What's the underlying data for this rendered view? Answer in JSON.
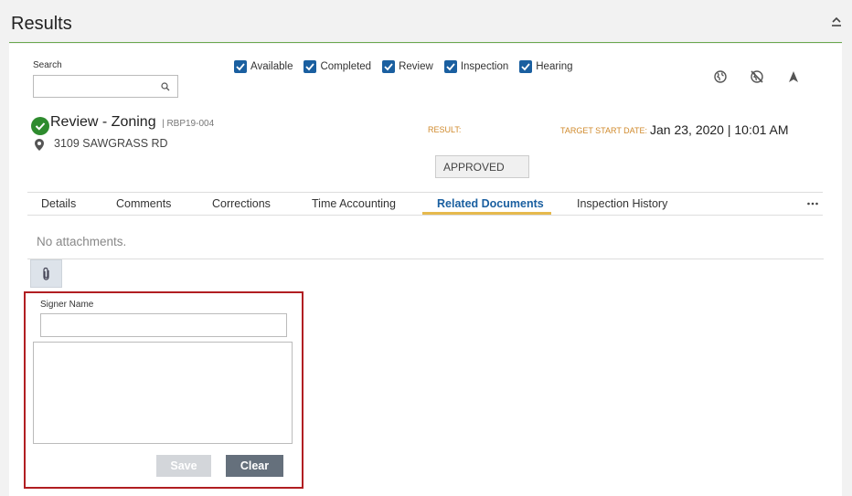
{
  "header": {
    "title": "Results"
  },
  "search": {
    "label": "Search",
    "value": "",
    "placeholder": ""
  },
  "filters": [
    {
      "label": "Available",
      "checked": true
    },
    {
      "label": "Completed",
      "checked": true
    },
    {
      "label": "Review",
      "checked": true
    },
    {
      "label": "Inspection",
      "checked": true
    },
    {
      "label": "Hearing",
      "checked": true
    }
  ],
  "toolbar_icons": [
    "globe-icon",
    "globe-off-icon",
    "navigate-icon"
  ],
  "record": {
    "status": "completed",
    "title": "Review - Zoning",
    "id": "| RBP19-004",
    "address": "3109 SAWGRASS RD"
  },
  "result": {
    "label": "RESULT:",
    "value": "APPROVED"
  },
  "target": {
    "label": "TARGET START DATE:",
    "value": "Jan 23, 2020 | 10:01 AM"
  },
  "tabs": [
    {
      "label": "Details",
      "active": false
    },
    {
      "label": "Comments",
      "active": false
    },
    {
      "label": "Corrections",
      "active": false
    },
    {
      "label": "Time Accounting",
      "active": false
    },
    {
      "label": "Related Documents",
      "active": true
    },
    {
      "label": "Inspection History",
      "active": false
    }
  ],
  "attachments": {
    "empty_text": "No attachments."
  },
  "signature": {
    "signer_label": "Signer Name",
    "signer_value": "",
    "save_label": "Save",
    "clear_label": "Clear"
  },
  "colors": {
    "accent": "#1a5fa0",
    "header_line": "#6aa84f",
    "label_orange": "#d08a2c",
    "tab_underline": "#e6b94d",
    "highlight_border": "#b11e22",
    "status_green": "#2e8b2e"
  }
}
